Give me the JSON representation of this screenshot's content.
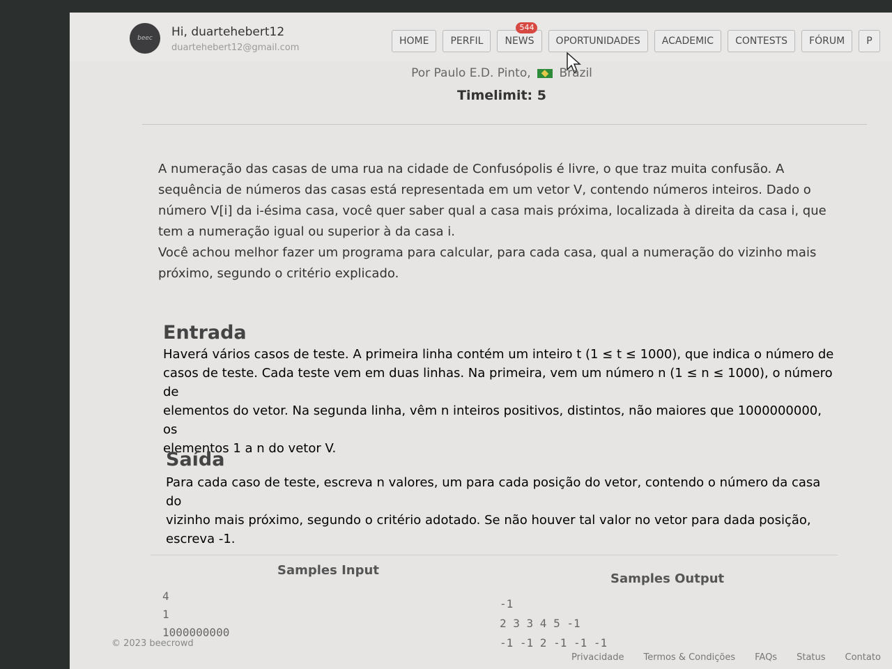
{
  "header": {
    "greeting": "Hi, duartehebert12",
    "email": "duartehebert12@gmail.com",
    "avatar_text": "beec"
  },
  "nav": {
    "items": [
      "HOME",
      "PERFIL",
      "NEWS",
      "OPORTUNIDADES",
      "ACADEMIC",
      "CONTESTS",
      "FÓRUM",
      "P"
    ],
    "news_badge": "544"
  },
  "problem": {
    "author_prefix": "Por Paulo E.D. Pinto,",
    "country": "Brazil",
    "timelimit": "Timelimit: 5",
    "description": [
      "A numeração das casas de uma rua na cidade de Confusópolis é livre, o que traz muita confusão. A",
      "sequência de números das casas está representada em um vetor V, contendo números inteiros. Dado o",
      "número V[i] da i-ésima casa, você quer saber qual a casa mais próxima, localizada à direita da casa i, que",
      "tem a numeração igual ou superior à da casa i.",
      "Você achou melhor fazer um programa para calcular, para cada casa, qual a numeração do vizinho mais",
      "próximo, segundo o critério explicado."
    ],
    "input_title": "Entrada",
    "input_text": [
      "Haverá vários casos de teste. A primeira linha contém um inteiro t (1 ≤ t ≤ 1000), que indica o número de",
      "casos de teste. Cada teste vem em duas linhas. Na primeira, vem um número n (1 ≤ n ≤ 1000), o número de",
      "elementos do vetor. Na segunda linha, vêm n inteiros positivos, distintos, não maiores que 1000000000, os",
      "elementos 1 a n do vetor V."
    ],
    "output_title": "Saída",
    "output_text": [
      "Para cada caso de teste, escreva n valores, um para cada posição do vetor, contendo o número da casa do",
      "vizinho mais próximo, segundo o critério adotado. Se não houver tal valor no vetor para dada posição,",
      "escreva -1."
    ],
    "samples_input_label": "Samples Input",
    "samples_output_label": "Samples Output",
    "samples_input": [
      "4",
      "1",
      "1000000000"
    ],
    "samples_output": [
      "-1",
      "2 3 3 4 5 -1",
      "-1 -1 2 -1 -1 -1"
    ]
  },
  "footer": {
    "copyright": "© 2023 beecrowd",
    "links": [
      "Privacidade",
      "Termos & Condições",
      "FAQs",
      "Status",
      "Contato"
    ]
  }
}
